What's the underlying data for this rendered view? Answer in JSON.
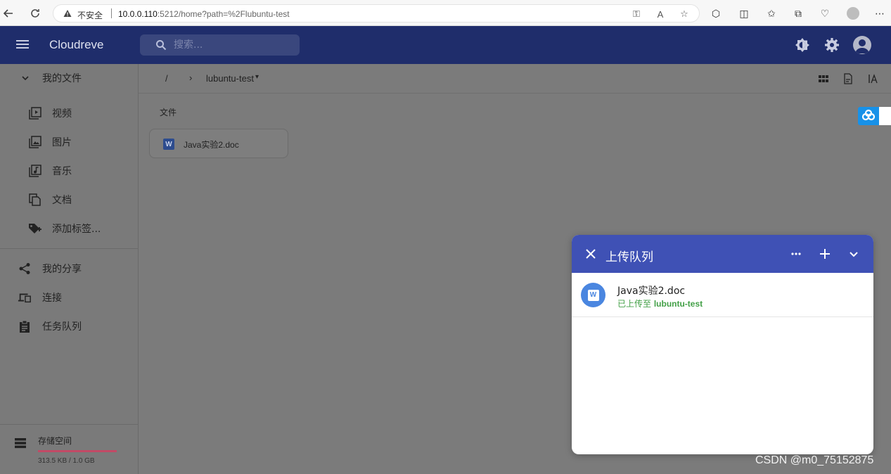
{
  "browser": {
    "insecure_label": "不安全",
    "url_host": "10.0.0.110",
    "url_rest": ":5212/home?path=%2Flubuntu-test",
    "icons": [
      "back-icon",
      "refresh-icon",
      "warning-icon",
      "key-icon",
      "read-aloud-icon",
      "favorite-icon",
      "extensions-icon",
      "split-screen-icon",
      "favorites-icon",
      "collections-icon",
      "performance-icon",
      "profile-icon",
      "more-icon"
    ]
  },
  "header": {
    "app_title": "Cloudreve",
    "search_placeholder": "搜索...",
    "brand_color": "#1f2d6b"
  },
  "sidebar": {
    "my_files": "我的文件",
    "items": [
      {
        "label": "视频",
        "icon": "video-icon"
      },
      {
        "label": "图片",
        "icon": "image-icon"
      },
      {
        "label": "音乐",
        "icon": "music-icon"
      },
      {
        "label": "文档",
        "icon": "document-icon"
      },
      {
        "label": "添加标签...",
        "icon": "tag-icon"
      }
    ],
    "share": "我的分享",
    "connect": "连接",
    "tasks": "任务队列",
    "storage_label": "存储空间",
    "storage_text": "313.5 KB / 1.0 GB",
    "storage_fraction": 1.0
  },
  "main": {
    "breadcrumb_root": "/",
    "breadcrumb_folder": "lubuntu-test",
    "section_title": "文件",
    "files": [
      {
        "name": "Java实验2.doc",
        "type": "word"
      }
    ]
  },
  "upload_dialog": {
    "title": "上传队列",
    "accent": "#3f51b5",
    "items": [
      {
        "file_name": "Java实验2.doc",
        "status_prefix": "已上传至 ",
        "status_target": "lubuntu-test"
      }
    ]
  },
  "watermark": "CSDN @m0_75152875"
}
